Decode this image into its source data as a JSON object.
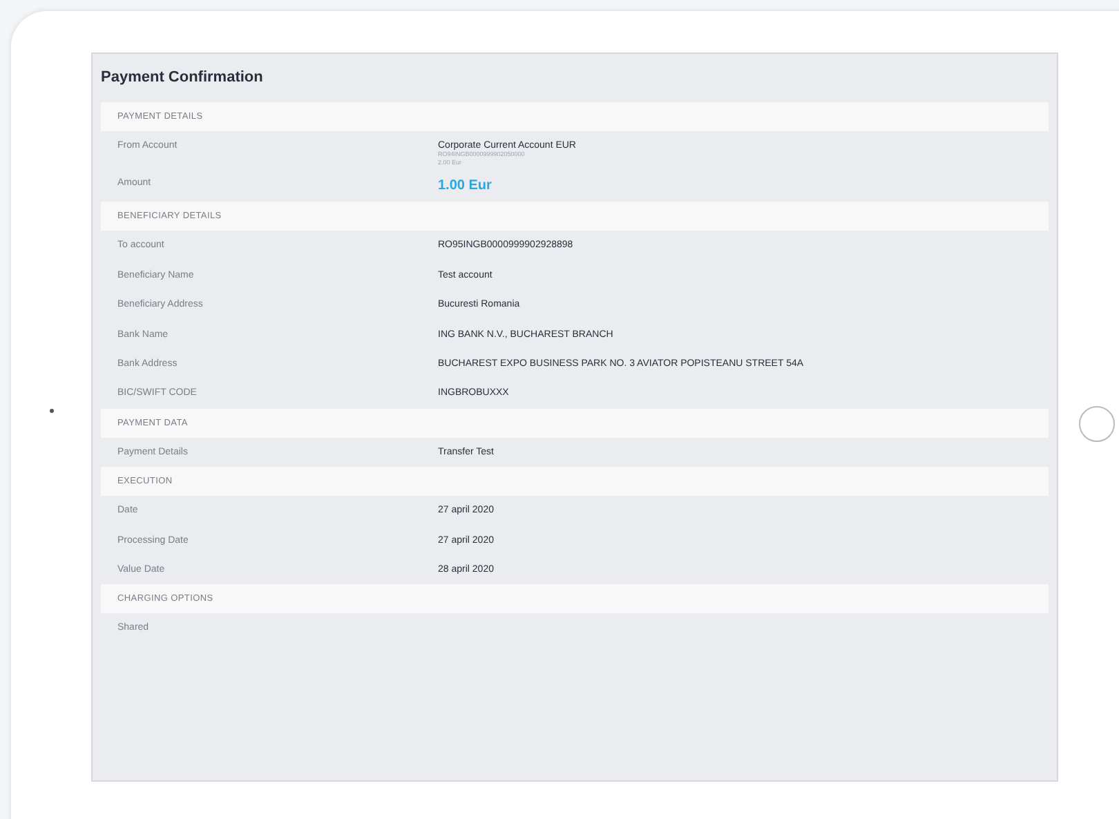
{
  "screen": {
    "title": "Payment Confirmation",
    "sections": [
      {
        "heading": "PAYMENT DETAILS",
        "rows": [
          {
            "kind": "account",
            "label": "From Account",
            "value": "Corporate Current Account EUR",
            "details": [
              "RO94INGB0000999902050000",
              "2.00 Eur"
            ]
          },
          {
            "kind": "amount",
            "label": "Amount",
            "value": "1.00 Eur"
          }
        ]
      },
      {
        "heading": "BENEFICIARY DETAILS",
        "rows": [
          {
            "kind": "text",
            "label": "To account",
            "value": "RO95INGB0000999902928898"
          },
          {
            "kind": "text",
            "label": "Beneficiary Name",
            "value": "Test account"
          },
          {
            "kind": "text",
            "label": "Beneficiary Address",
            "value": "Bucuresti Romania"
          },
          {
            "kind": "text",
            "label": "Bank Name",
            "value": "ING BANK N.V., BUCHAREST BRANCH"
          },
          {
            "kind": "text",
            "label": "Bank Address",
            "value": "BUCHAREST EXPO BUSINESS PARK NO. 3 AVIATOR POPISTEANU STREET 54A"
          },
          {
            "kind": "text",
            "label": "BIC/SWIFT CODE",
            "value": "INGBROBUXXX"
          }
        ]
      },
      {
        "heading": "PAYMENT DATA",
        "rows": [
          {
            "kind": "text",
            "label": "Payment Details",
            "value": "Transfer Test"
          }
        ]
      },
      {
        "heading": "EXECUTION",
        "rows": [
          {
            "kind": "text",
            "label": "Date",
            "value": "27 april 2020"
          },
          {
            "kind": "text",
            "label": "Processing Date",
            "value": "27 april 2020"
          },
          {
            "kind": "text",
            "label": "Value Date",
            "value": "28 april 2020"
          }
        ]
      },
      {
        "heading": "CHARGING OPTIONS",
        "rows": [
          {
            "kind": "plain",
            "label": "Shared"
          }
        ]
      }
    ]
  }
}
